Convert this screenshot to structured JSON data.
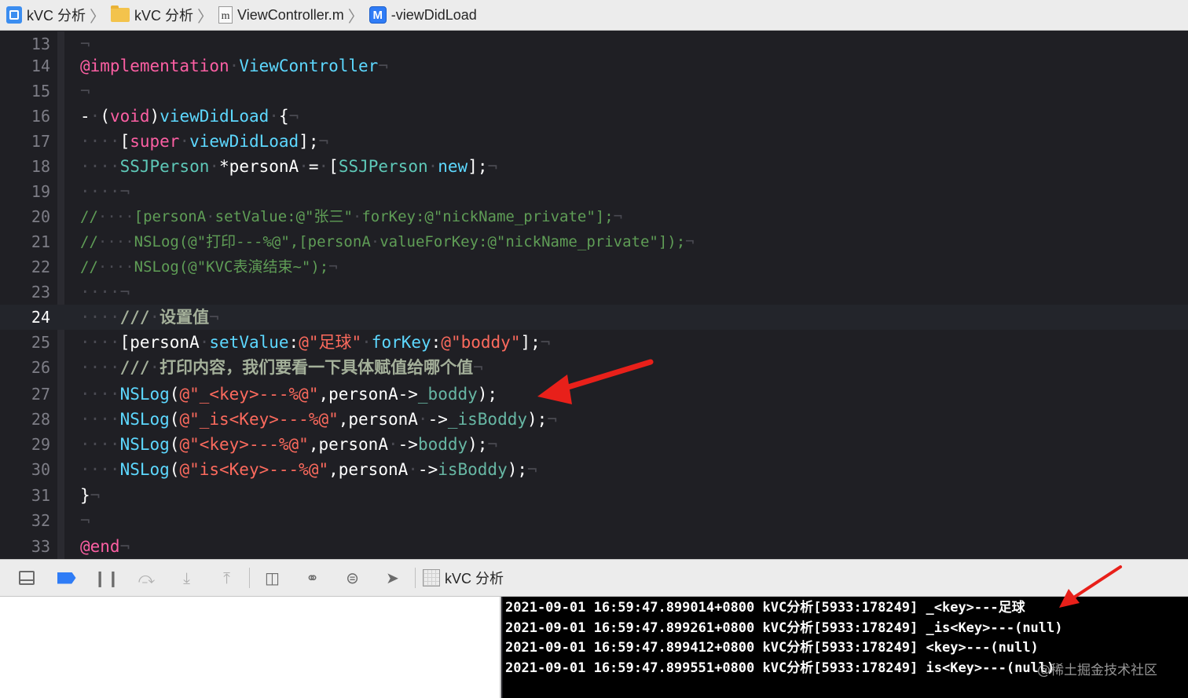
{
  "breadcrumb": {
    "project": "kVC 分析",
    "folder": "kVC 分析",
    "file": "ViewController.m",
    "file_icon_letter": "m",
    "method_icon_letter": "M",
    "method": "-viewDidLoad"
  },
  "editor": {
    "current_line": "24",
    "lines": [
      {
        "num": "13",
        "tokens": [
          {
            "t": "¬",
            "c": "ws"
          }
        ]
      },
      {
        "num": "14",
        "tokens": [
          {
            "t": "@implementation",
            "c": "kw"
          },
          {
            "t": "·",
            "c": "ws"
          },
          {
            "t": "ViewController",
            "c": "ty"
          },
          {
            "t": "¬",
            "c": "ws"
          }
        ]
      },
      {
        "num": "15",
        "tokens": [
          {
            "t": "¬",
            "c": "ws"
          }
        ]
      },
      {
        "num": "16",
        "tokens": [
          {
            "t": "-",
            "c": ""
          },
          {
            "t": "·",
            "c": "ws"
          },
          {
            "t": "(",
            "c": ""
          },
          {
            "t": "void",
            "c": "kw"
          },
          {
            "t": ")",
            "c": ""
          },
          {
            "t": "viewDidLoad",
            "c": "ty"
          },
          {
            "t": "·",
            "c": "ws"
          },
          {
            "t": "{",
            "c": ""
          },
          {
            "t": "¬",
            "c": "ws"
          }
        ]
      },
      {
        "num": "17",
        "tokens": [
          {
            "t": "····",
            "c": "ws"
          },
          {
            "t": "[",
            "c": ""
          },
          {
            "t": "super",
            "c": "kw"
          },
          {
            "t": "·",
            "c": "ws"
          },
          {
            "t": "viewDidLoad",
            "c": "ty"
          },
          {
            "t": "];",
            "c": ""
          },
          {
            "t": "¬",
            "c": "ws"
          }
        ]
      },
      {
        "num": "18",
        "tokens": [
          {
            "t": "····",
            "c": "ws"
          },
          {
            "t": "SSJPerson",
            "c": "cls2"
          },
          {
            "t": "·",
            "c": "ws"
          },
          {
            "t": "*personA",
            "c": ""
          },
          {
            "t": "·",
            "c": "ws"
          },
          {
            "t": "=",
            "c": ""
          },
          {
            "t": "·",
            "c": "ws"
          },
          {
            "t": "[",
            "c": ""
          },
          {
            "t": "SSJPerson",
            "c": "cls2"
          },
          {
            "t": "·",
            "c": "ws"
          },
          {
            "t": "new",
            "c": "ty"
          },
          {
            "t": "];",
            "c": ""
          },
          {
            "t": "¬",
            "c": "ws"
          }
        ]
      },
      {
        "num": "19",
        "tokens": [
          {
            "t": "····¬",
            "c": "ws"
          }
        ]
      },
      {
        "num": "20",
        "cmt": true,
        "tokens": [
          {
            "t": "//",
            "c": "comg"
          },
          {
            "t": "····",
            "c": "ws"
          },
          {
            "t": "[personA",
            "c": "comg"
          },
          {
            "t": "·",
            "c": "ws"
          },
          {
            "t": "setValue:@\"张三\"",
            "c": "comg"
          },
          {
            "t": "·",
            "c": "ws"
          },
          {
            "t": "forKey:@\"nickName_private\"];",
            "c": "comg"
          },
          {
            "t": "¬",
            "c": "ws"
          }
        ]
      },
      {
        "num": "21",
        "cmt": true,
        "tokens": [
          {
            "t": "//",
            "c": "comg"
          },
          {
            "t": "····",
            "c": "ws"
          },
          {
            "t": "NSLog(@\"打印---%@\",[personA",
            "c": "comg"
          },
          {
            "t": "·",
            "c": "ws"
          },
          {
            "t": "valueForKey:@\"nickName_private\"]);",
            "c": "comg"
          },
          {
            "t": "¬",
            "c": "ws"
          }
        ]
      },
      {
        "num": "22",
        "cmt": true,
        "tokens": [
          {
            "t": "//",
            "c": "comg"
          },
          {
            "t": "····",
            "c": "ws"
          },
          {
            "t": "NSLog(@\"KVC表演结束~\");",
            "c": "comg"
          },
          {
            "t": "¬",
            "c": "ws"
          }
        ]
      },
      {
        "num": "23",
        "tokens": [
          {
            "t": "····¬",
            "c": "ws"
          }
        ]
      },
      {
        "num": "24",
        "tokens": [
          {
            "t": "····",
            "c": "ws"
          },
          {
            "t": "///",
            "c": "doc"
          },
          {
            "t": "·",
            "c": "ws"
          },
          {
            "t": "设置值",
            "c": "doc"
          },
          {
            "t": "¬",
            "c": "ws"
          }
        ]
      },
      {
        "num": "25",
        "tokens": [
          {
            "t": "····",
            "c": "ws"
          },
          {
            "t": "[personA",
            "c": ""
          },
          {
            "t": "·",
            "c": "ws"
          },
          {
            "t": "setValue",
            "c": "ty"
          },
          {
            "t": ":",
            "c": ""
          },
          {
            "t": "@\"足球\"",
            "c": "str"
          },
          {
            "t": "·",
            "c": "ws"
          },
          {
            "t": "forKey",
            "c": "ty"
          },
          {
            "t": ":",
            "c": ""
          },
          {
            "t": "@\"boddy\"",
            "c": "str"
          },
          {
            "t": "];",
            "c": ""
          },
          {
            "t": "¬",
            "c": "ws"
          }
        ]
      },
      {
        "num": "26",
        "tokens": [
          {
            "t": "····",
            "c": "ws"
          },
          {
            "t": "///",
            "c": "doc"
          },
          {
            "t": "·",
            "c": "ws"
          },
          {
            "t": "打印内容，我们要看一下具体赋值给哪个值",
            "c": "doc"
          },
          {
            "t": "¬",
            "c": "ws"
          }
        ]
      },
      {
        "num": "27",
        "tokens": [
          {
            "t": "····",
            "c": "ws"
          },
          {
            "t": "NSLog",
            "c": "ty"
          },
          {
            "t": "(",
            "c": ""
          },
          {
            "t": "@\"_<key>---%@\"",
            "c": "str"
          },
          {
            "t": ",personA->",
            "c": ""
          },
          {
            "t": "_boddy",
            "c": "cls"
          },
          {
            "t": ");",
            "c": ""
          }
        ]
      },
      {
        "num": "28",
        "tokens": [
          {
            "t": "····",
            "c": "ws"
          },
          {
            "t": "NSLog",
            "c": "ty"
          },
          {
            "t": "(",
            "c": ""
          },
          {
            "t": "@\"_is<Key>---%@\"",
            "c": "str"
          },
          {
            "t": ",personA",
            "c": ""
          },
          {
            "t": "·",
            "c": "ws"
          },
          {
            "t": "->",
            "c": ""
          },
          {
            "t": "_isBoddy",
            "c": "cls"
          },
          {
            "t": ");",
            "c": ""
          },
          {
            "t": "¬",
            "c": "ws"
          }
        ]
      },
      {
        "num": "29",
        "tokens": [
          {
            "t": "····",
            "c": "ws"
          },
          {
            "t": "NSLog",
            "c": "ty"
          },
          {
            "t": "(",
            "c": ""
          },
          {
            "t": "@\"<key>---%@\"",
            "c": "str"
          },
          {
            "t": ",personA",
            "c": ""
          },
          {
            "t": "·",
            "c": "ws"
          },
          {
            "t": "->",
            "c": ""
          },
          {
            "t": "boddy",
            "c": "cls"
          },
          {
            "t": ");",
            "c": ""
          },
          {
            "t": "¬",
            "c": "ws"
          }
        ]
      },
      {
        "num": "30",
        "tokens": [
          {
            "t": "····",
            "c": "ws"
          },
          {
            "t": "NSLog",
            "c": "ty"
          },
          {
            "t": "(",
            "c": ""
          },
          {
            "t": "@\"is<Key>---%@\"",
            "c": "str"
          },
          {
            "t": ",personA",
            "c": ""
          },
          {
            "t": "·",
            "c": "ws"
          },
          {
            "t": "->",
            "c": ""
          },
          {
            "t": "isBoddy",
            "c": "cls"
          },
          {
            "t": ");",
            "c": ""
          },
          {
            "t": "¬",
            "c": "ws"
          }
        ]
      },
      {
        "num": "31",
        "tokens": [
          {
            "t": "}",
            "c": ""
          },
          {
            "t": "¬",
            "c": "ws"
          }
        ]
      },
      {
        "num": "32",
        "tokens": [
          {
            "t": "¬",
            "c": "ws"
          }
        ]
      },
      {
        "num": "33",
        "tokens": [
          {
            "t": "@end",
            "c": "kw"
          },
          {
            "t": "¬",
            "c": "ws"
          }
        ]
      }
    ]
  },
  "debugbar": {
    "target_label": "kVC 分析",
    "icons": [
      "hide-debug-area-icon",
      "breakpoints-toggle-icon",
      "pause-icon",
      "step-over-icon",
      "step-into-icon",
      "step-out-icon",
      "view-debugger-icon",
      "memory-graph-icon",
      "environment-overrides-icon",
      "simulate-location-icon"
    ]
  },
  "console": {
    "lines": [
      "2021-09-01 16:59:47.899014+0800 kVC分析[5933:178249] _<key>---足球",
      "2021-09-01 16:59:47.899261+0800 kVC分析[5933:178249] _is<Key>---(null)",
      "2021-09-01 16:59:47.899412+0800 kVC分析[5933:178249] <key>---(null)",
      "2021-09-01 16:59:47.899551+0800 kVC分析[5933:178249] is<Key>---(null)"
    ]
  },
  "watermark": "@稀土掘金技术社区",
  "colors": {
    "editor_bg": "#1f1f24",
    "keyword": "#fc5fa3",
    "type": "#5dd8ff",
    "string": "#fc6a5d",
    "comment": "#5f9d56",
    "annotation_arrow": "#e8201a"
  }
}
